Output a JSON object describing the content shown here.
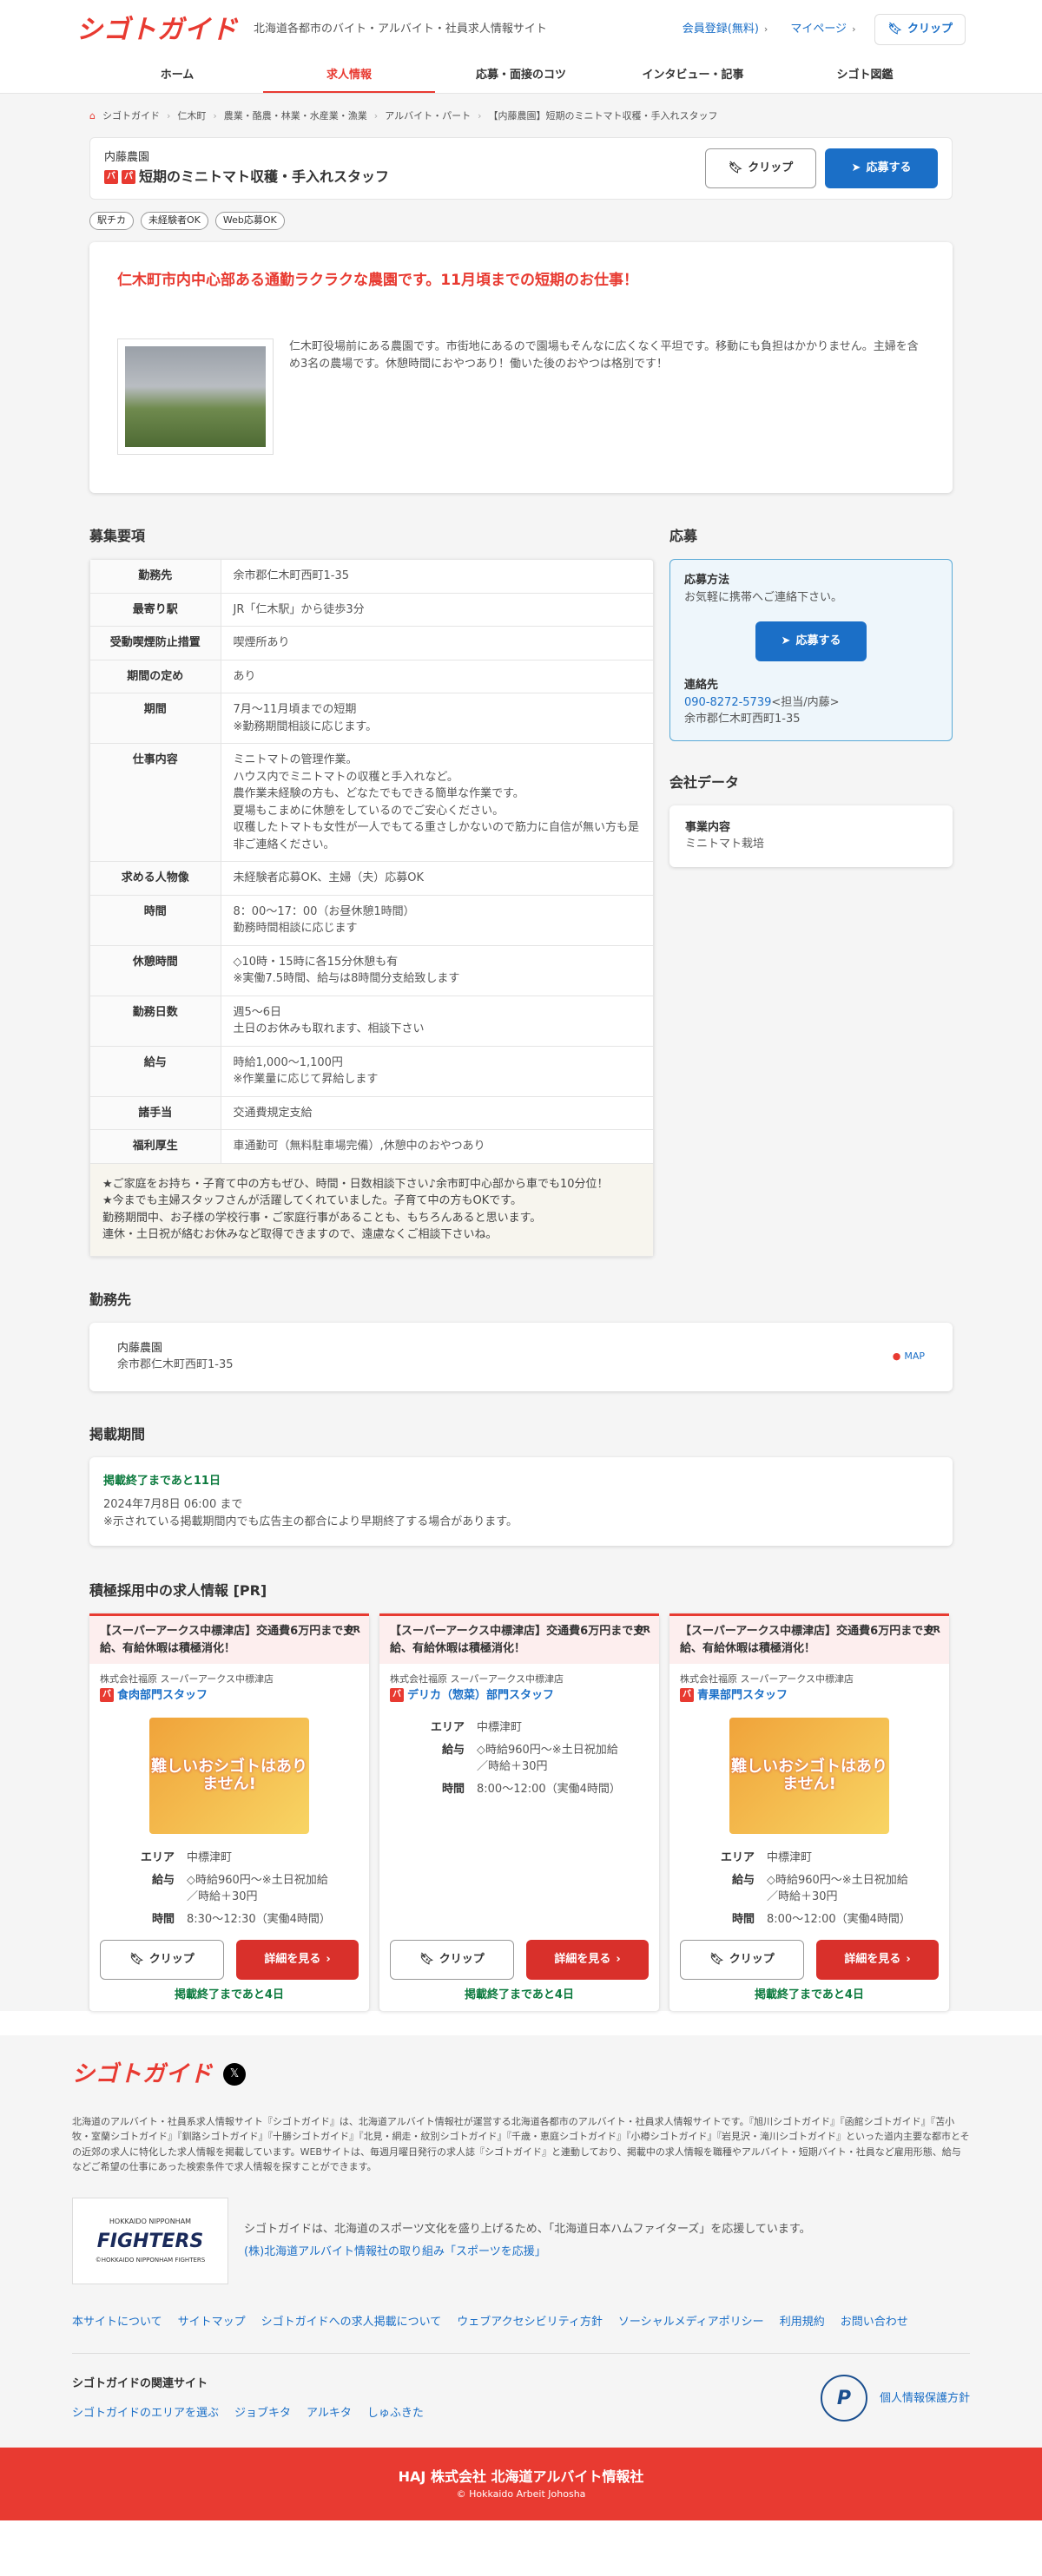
{
  "header": {
    "logo": "シゴトガイド",
    "tagline": "北海道各都市のバイト・アルバイト・社員求人情報サイト",
    "register": "会員登録(無料)",
    "mypage": "マイページ",
    "clip": "クリップ"
  },
  "nav": [
    "ホーム",
    "求人情報",
    "応募・面接のコツ",
    "インタビュー・記事",
    "シゴト図鑑"
  ],
  "breadcrumb": [
    "シゴトガイド",
    "仁木町",
    "農業・酪農・林業・水産業・漁業",
    "アルバイト・パート",
    "【内藤農園】短期のミニトマト収穫・手入れスタッフ"
  ],
  "job": {
    "company": "内藤農園",
    "tags": [
      "バ",
      "パ"
    ],
    "title": "短期のミニトマト収穫・手入れスタッフ",
    "clip": "クリップ",
    "apply": "応募する",
    "chips": [
      "駅チカ",
      "未経験者OK",
      "Web応募OK"
    ]
  },
  "intro": {
    "headline": "仁木町市内中心部ある通勤ラクラクな農園です。11月頃までの短期のお仕事！",
    "text": "仁木町役場前にある農園です。市街地にあるので園場もそんなに広くなく平坦です。移動にも負担はかかりません。主婦を含め3名の農場です。休憩時間におやつあり！働いた後のおやつは格別です！"
  },
  "requirements": {
    "title": "募集要項",
    "rows": [
      {
        "k": "勤務先",
        "v": "余市郡仁木町西町1-35"
      },
      {
        "k": "最寄り駅",
        "v": "JR「仁木駅」から徒歩3分"
      },
      {
        "k": "受動喫煙防止措置",
        "v": "喫煙所あり"
      },
      {
        "k": "期間の定め",
        "v": "あり"
      },
      {
        "k": "期間",
        "v": "7月〜11月頃までの短期\n※勤務期間相談に応じます。"
      },
      {
        "k": "仕事内容",
        "v": "ミニトマトの管理作業。\nハウス内でミニトマトの収穫と手入れなど。\n農作業未経験の方も、どなたでもできる簡単な作業です。\n夏場もこまめに休憩をしているのでご安心ください。\n収穫したトマトも女性が一人でもてる重さしかないので筋力に自信が無い方も是非ご連絡ください。"
      },
      {
        "k": "求める人物像",
        "v": "未経験者応募OK、主婦（夫）応募OK"
      },
      {
        "k": "時間",
        "v": "8：00〜17：00（お昼休憩1時間）\n勤務時間相談に応じます"
      },
      {
        "k": "休憩時間",
        "v": "◇10時・15時に各15分休憩も有\n※実働7.5時間、給与は8時間分支給致します"
      },
      {
        "k": "勤務日数",
        "v": "週5〜6日\n土日のお休みも取れます、相談下さい"
      },
      {
        "k": "給与",
        "v": "時給1,000〜1,100円\n※作業量に応じて昇給します"
      },
      {
        "k": "諸手当",
        "v": "交通費規定支給"
      },
      {
        "k": "福利厚生",
        "v": "車通勤可（無料駐車場完備）,休憩中のおやつあり"
      }
    ],
    "note": "★ご家庭をお持ち・子育て中の方もぜひ、時間・日数相談下さい♪余市町中心部から車でも10分位！\n★今までも主婦スタッフさんが活躍してくれていました。子育て中の方もOKです。\n勤務期間中、お子様の学校行事・ご家庭行事があることも、もちろんあると思います。\n連休・土日祝が絡むお休みなど取得できますので、遠慮なくご相談下さいね。"
  },
  "apply": {
    "title": "応募",
    "method_label": "応募方法",
    "method": "お気軽に携帯へご連絡下さい。",
    "button": "応募する",
    "contact_label": "連絡先",
    "tel": "090-8272-5739",
    "tel_note": "<担当/内藤>",
    "address": "余市郡仁木町西町1-35"
  },
  "company": {
    "title": "会社データ",
    "label": "事業内容",
    "value": "ミニトマト栽培"
  },
  "workplace": {
    "title": "勤務先",
    "name": "内藤農園",
    "address": "余市郡仁木町西町1-35",
    "map": "MAP"
  },
  "period": {
    "title": "掲載期間",
    "remaining": "掲載終了まであと11日",
    "until": "2024年7月8日 06:00 まで",
    "note": "※示されている掲載期間内でも広告主の都合により早期終了する場合があります。"
  },
  "pr": {
    "title": "積極採用中の求人情報 [PR]",
    "cards": [
      {
        "head": "【スーパーアークス中標津店】交通費6万円まで支給、有給休暇は積極消化！",
        "pr": "PR",
        "company": "株式会社福原 スーパーアークス中標津店",
        "position": "食肉部門スタッフ",
        "poster": "難しいおシゴトはありません!",
        "area": "中標津町",
        "pay": "◇時給960円〜※土日祝加給\n／時給＋30円",
        "time": "8:30〜12:30（実働4時間）",
        "clip": "クリップ",
        "detail": "詳細を見る",
        "end": "掲載終了まであと4日"
      },
      {
        "head": "【スーパーアークス中標津店】交通費6万円まで支給、有給休暇は積極消化！",
        "pr": "PR",
        "company": "株式会社福原 スーパーアークス中標津店",
        "position": "デリカ（惣菜）部門スタッフ",
        "poster": "",
        "area": "中標津町",
        "pay": "◇時給960円〜※土日祝加給\n／時給＋30円",
        "time": "8:00〜12:00（実働4時間）",
        "clip": "クリップ",
        "detail": "詳細を見る",
        "end": "掲載終了まであと4日"
      },
      {
        "head": "【スーパーアークス中標津店】交通費6万円まで支給、有給休暇は積極消化！",
        "pr": "PR",
        "company": "株式会社福原 スーパーアークス中標津店",
        "position": "青果部門スタッフ",
        "poster": "難しいおシゴトはありません!",
        "area": "中標津町",
        "pay": "◇時給960円〜※土日祝加給\n／時給＋30円",
        "time": "8:00〜12:00（実働4時間）",
        "clip": "クリップ",
        "detail": "詳細を見る",
        "end": "掲載終了まであと4日"
      }
    ],
    "labels": {
      "area": "エリア",
      "pay": "給与",
      "time": "時間"
    }
  },
  "footer": {
    "logo": "シゴトガイド",
    "desc": "北海道のアルバイト・社員系求人情報サイト『シゴトガイド』は、北海道アルバイト情報社が運営する北海道各都市のアルバイト・社員求人情報サイトです。『旭川シゴトガイド』『函館シゴトガイド』『苫小牧・室蘭シゴトガイド』『釧路シゴトガイド』『十勝シゴトガイド』『北見・網走・紋別シゴトガイド』『千歳・恵庭シゴトガイド』『小樽シゴトガイド』『岩見沢・滝川シゴトガイド』といった道内主要な都市とその近郊の求人に特化した求人情報を掲載しています。WEBサイトは、毎週月曜日発行の求人誌『シゴトガイド』と連動しており、掲載中の求人情報を職種やアルバイト・短期バイト・社員など雇用形態、給与などご希望の仕事にあった検索条件で求人情報を探すことができます。",
    "fighters_1": "HOKKAIDO NIPPONHAM",
    "fighters_2": "FIGHTERS",
    "fighters_3": "©HOKKAIDO NIPPONHAM FIGHTERS",
    "sports_text": "シゴトガイドは、北海道のスポーツ文化を盛り上げるため、「北海道日本ハムファイターズ」を応援しています。",
    "sports_link": "(株)北海道アルバイト情報社の取り組み「スポーツを応援」",
    "links": [
      "本サイトについて",
      "サイトマップ",
      "シゴトガイドへの求人掲載について",
      "ウェブアクセシビリティ方針",
      "ソーシャルメディアポリシー",
      "利用規約",
      "お問い合わせ"
    ],
    "related_title": "シゴトガイドの関連サイト",
    "related": [
      "シゴトガイドのエリアを選ぶ",
      "ジョブキタ",
      "アルキタ",
      "しゅふきた"
    ],
    "privacy": "個人情報保護方針",
    "company": "HAJ 株式会社 北海道アルバイト情報社",
    "copyright": "© Hokkaido Arbeit Johosha"
  }
}
